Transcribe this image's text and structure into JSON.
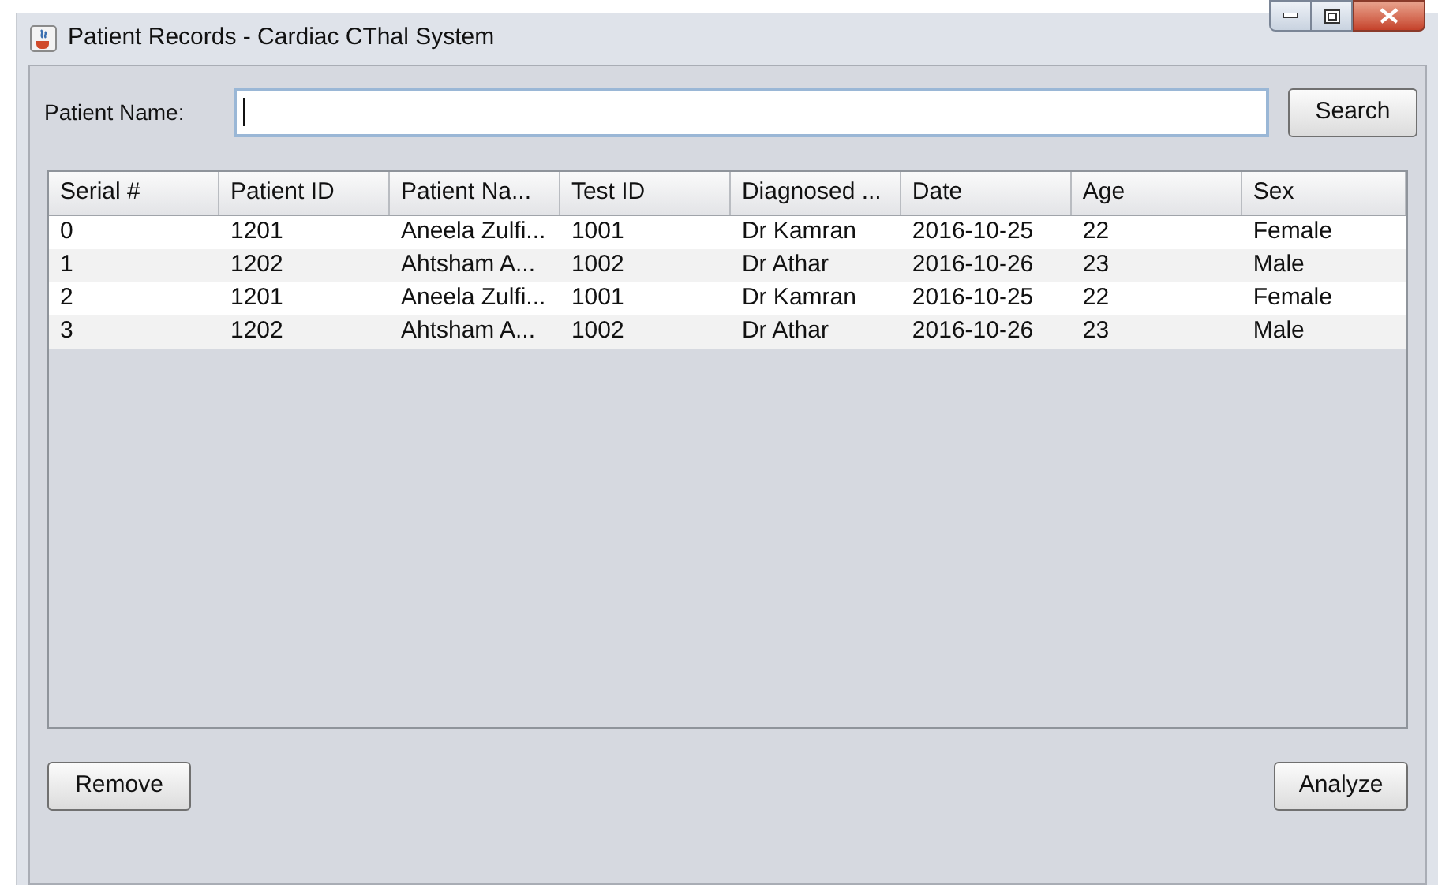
{
  "window": {
    "title": "Patient Records - Cardiac CThal System"
  },
  "search": {
    "label": "Patient Name:",
    "button": "Search"
  },
  "table": {
    "columns": [
      "Serial #",
      "Patient ID",
      "Patient Na...",
      "Test ID",
      "Diagnosed ...",
      "Date",
      "Age",
      "Sex"
    ],
    "rows": [
      [
        "0",
        "1201",
        "Aneela Zulfi...",
        "1001",
        "Dr Kamran",
        "2016-10-25",
        "22",
        "Female"
      ],
      [
        "1",
        "1202",
        "Ahtsham A...",
        "1002",
        "Dr Athar",
        "2016-10-26",
        "23",
        "Male"
      ],
      [
        "2",
        "1201",
        "Aneela Zulfi...",
        "1001",
        "Dr Kamran",
        "2016-10-25",
        "22",
        "Female"
      ],
      [
        "3",
        "1202",
        "Ahtsham A...",
        "1002",
        "Dr Athar",
        "2016-10-26",
        "23",
        "Male"
      ]
    ]
  },
  "buttons": {
    "left": "Remove",
    "right": "Analyze"
  }
}
